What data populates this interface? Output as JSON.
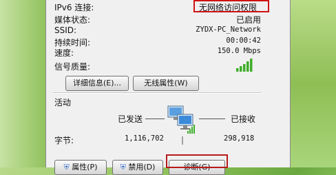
{
  "rows": [
    {
      "label": "IPv6 连接:",
      "value": "无网络访问权限"
    },
    {
      "label": "媒体状态:",
      "value": "已启用"
    },
    {
      "label": "SSID:",
      "value": "ZYDX-PC_Network"
    },
    {
      "label": "持续时间:",
      "value": "00:00:42"
    },
    {
      "label": "速度:",
      "value": "150.0 Mbps"
    }
  ],
  "signal_label": "信号质量:",
  "signal_bars": 5,
  "buttons": {
    "details": "详细信息(E)...",
    "wireless_props": "无线属性(W)",
    "properties": "属性(P)",
    "disable": "禁用(D)",
    "diagnose": "诊断(G)"
  },
  "activity": {
    "title": "活动",
    "sent_label": "已发送",
    "received_label": "已接收",
    "bytes_label": "字节:",
    "bytes_sent": "1,116,702",
    "bytes_received": "298,918"
  },
  "colors": {
    "highlight_border": "#d01010",
    "signal_green": "#3fae2a"
  }
}
